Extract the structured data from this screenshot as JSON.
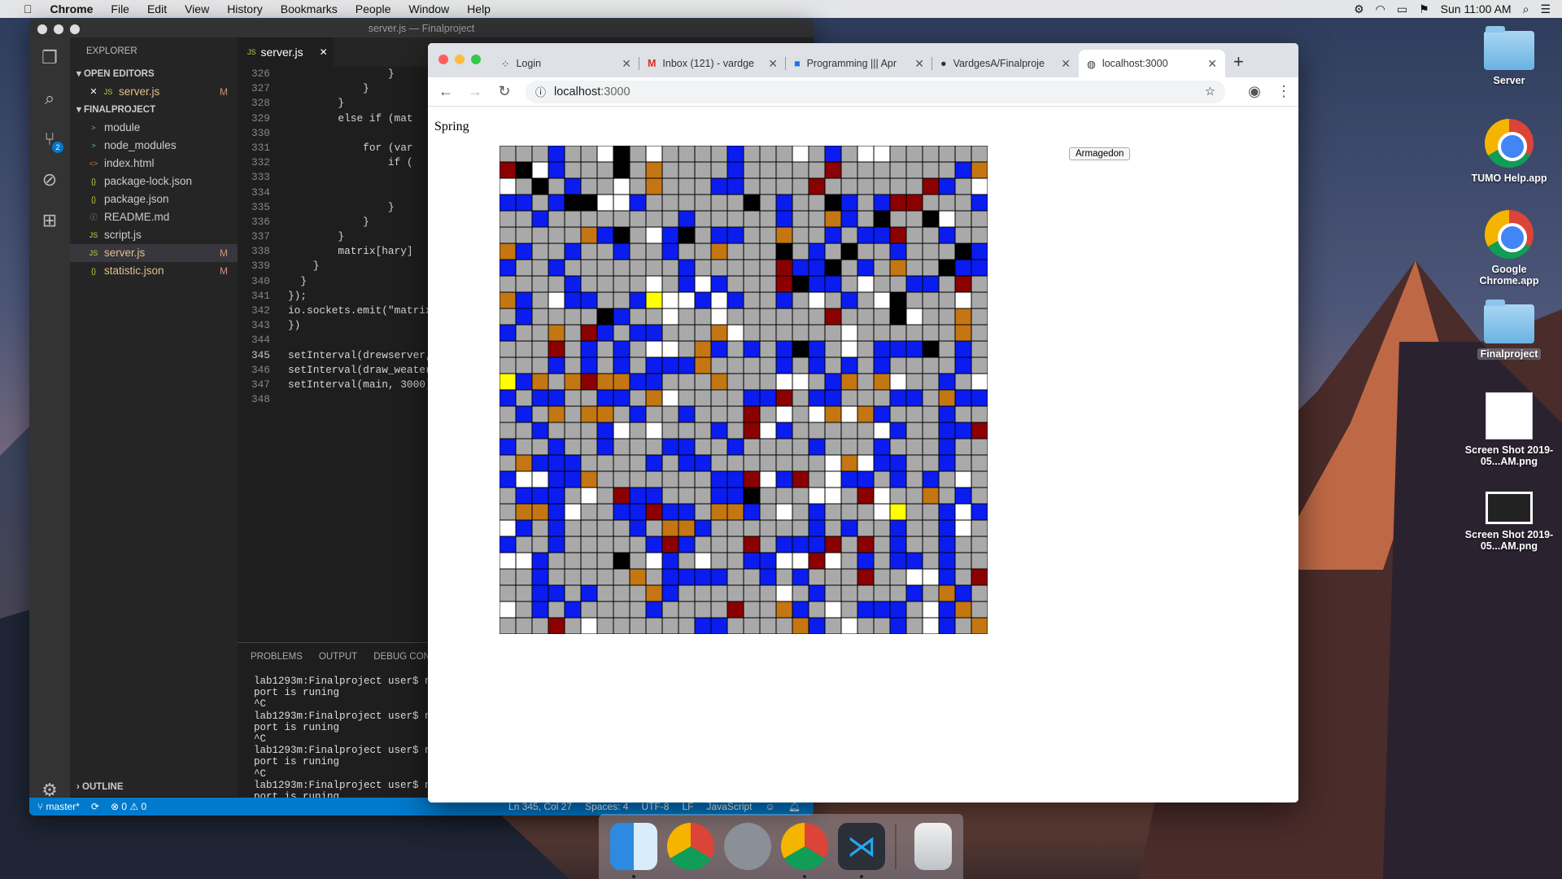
{
  "menubar": {
    "apple": "",
    "app": "Chrome",
    "items": [
      "File",
      "Edit",
      "View",
      "History",
      "Bookmarks",
      "People",
      "Window",
      "Help"
    ],
    "clock": "Sun 11:00 AM"
  },
  "vscode": {
    "title": "server.js — Finalproject",
    "explorer_label": "EXPLORER",
    "open_editors_label": "OPEN EDITORS",
    "open_editor_file": "server.js",
    "open_editor_status": "M",
    "project_label": "FINALPROJECT",
    "scm_badge": "2",
    "files": [
      {
        "name": "module",
        "icon": ">",
        "status": ""
      },
      {
        "name": "node_modules",
        "icon": ">",
        "status": ""
      },
      {
        "name": "index.html",
        "icon": "<>",
        "status": ""
      },
      {
        "name": "package-lock.json",
        "icon": "{}",
        "status": ""
      },
      {
        "name": "package.json",
        "icon": "{}",
        "status": ""
      },
      {
        "name": "README.md",
        "icon": "ⓘ",
        "status": ""
      },
      {
        "name": "script.js",
        "icon": "JS",
        "status": ""
      },
      {
        "name": "server.js",
        "icon": "JS",
        "status": "M"
      },
      {
        "name": "statistic.json",
        "icon": "{}",
        "status": "M"
      }
    ],
    "outline_label": "OUTLINE",
    "tab": "server.js",
    "code_lines": [
      {
        "n": "326",
        "t": "                }"
      },
      {
        "n": "327",
        "t": "            }"
      },
      {
        "n": "328",
        "t": "        }"
      },
      {
        "n": "329",
        "t": "        else if (mat"
      },
      {
        "n": "330",
        "t": ""
      },
      {
        "n": "331",
        "t": "            for (var"
      },
      {
        "n": "332",
        "t": "                if ("
      },
      {
        "n": "333",
        "t": ""
      },
      {
        "n": "334",
        "t": ""
      },
      {
        "n": "335",
        "t": "                }"
      },
      {
        "n": "336",
        "t": "            }"
      },
      {
        "n": "337",
        "t": "        }"
      },
      {
        "n": "338",
        "t": "        matrix[hary]"
      },
      {
        "n": "339",
        "t": "    }"
      },
      {
        "n": "340",
        "t": "  }"
      },
      {
        "n": "341",
        "t": "});"
      },
      {
        "n": "342",
        "t": "io.sockets.emit(\"matrix\""
      },
      {
        "n": "343",
        "t": "})"
      },
      {
        "n": "344",
        "t": ""
      },
      {
        "n": "345",
        "t": "setInterval(drewserver, 1500"
      },
      {
        "n": "346",
        "t": "setInterval(draw_weater, 700"
      },
      {
        "n": "347",
        "t": "setInterval(main, 3000);"
      },
      {
        "n": "348",
        "t": ""
      }
    ],
    "panel_tabs": [
      "PROBLEMS",
      "OUTPUT",
      "DEBUG CONSOLE"
    ],
    "terminal": [
      "lab1293m:Finalproject user$ node ser",
      "port is runing",
      "^C",
      "lab1293m:Finalproject user$ node ser",
      "port is runing",
      "^C",
      "lab1293m:Finalproject user$ node ser",
      "port is runing",
      "^C",
      "lab1293m:Finalproject user$ node ser",
      "port is runing"
    ],
    "status": {
      "branch": "master*",
      "errors": "0",
      "warnings": "0",
      "position": "Ln 345, Col 27",
      "spaces": "Spaces: 4",
      "encoding": "UTF-8",
      "eol": "LF",
      "language": "JavaScript"
    }
  },
  "chrome": {
    "tabs": [
      {
        "title": "Login",
        "icon": "dots-icon"
      },
      {
        "title": "Inbox (121) - vardge",
        "icon": "gmail-icon"
      },
      {
        "title": "Programming ||| Apr",
        "icon": "classroom-icon"
      },
      {
        "title": "VardgesA/Finalproje",
        "icon": "github-icon"
      },
      {
        "title": "localhost:3000",
        "icon": "globe-icon"
      }
    ],
    "address_host": "localhost",
    "address_port": ":3000",
    "page": {
      "season": "Spring",
      "button": "Armagedon",
      "grid_cols": 30,
      "grid_rows": 30,
      "colors": {
        "g": "#a9a9a9",
        "b": "#0a1cf0",
        "w": "#ffffff",
        "k": "#000000",
        "r": "#8b0000",
        "o": "#c47612",
        "y": "#ffff00"
      },
      "matrix": [
        "gggbggwkgwggggbgggwgbgwwgggggg",
        "rkwbgggkgoggggbgggggrgggggggbo",
        "wgkgbggwgogggbbggggrggggggrbgw",
        "bbgbkkwwbggggggkgbggkbgbrrgggb",
        "ggbggggggggbgggggbggobgkggkwgg",
        "gggggobkgwbkgbbggoggbgbbrggbgg",
        "obggbggbggbggogggkgbgkggbgggkb",
        "bggbgggggggbgggggrbbkgbgoggkbb",
        "ggggbggggwgbwbgggrkbbgwggbbgrg",
        "obgwbbggbywwbwbggbgwgbgwkgggwg",
        "gbggggkbggwggwggggggrgggkwggog",
        "bggogrbgbbgggowggggggwggggggog",
        "gggrgbgbgwwgobgbgbkbgwgbbbkgbg",
        "gggbgbgbgbbboggggbgbgbgbggggbg",
        "ybogoroobbgggogggwwgbogowggbgw",
        "bgbbggbbgowggggbbrgbbgggbbgobb",
        "gbgogoogbggbgggrgwgwowobgggbgg",
        "ggbgggbwgwgggbgrwbgggggwbggbbr",
        "bggbggbgggbbggbggggbgggbgggbgg",
        "gobbbggggbgbbgggggggwowbbggbgg",
        "bwwbbogggggggbbrwbrgwbbgbgbgwg",
        "gbbbgwgrbbgggbbkgggwwgrwggogbg",
        "goobwggbbrbbgoobgwgbgggwyggbwb",
        "wbgbggggbgoobggggggbgbggbggbwg",
        "bggbgggggbrbgggrgbbbrgrgbggbgg",
        "wwbggggkgwbgwggbbwwrwgbgbbgbgg",
        "ggbgggggogbbbbggbgbgggrggwwbgr",
        "ggbbgbgggobggggggwgbgggggbgobg",
        "wgbgbggggbggggrggobgwgbbbgwbog",
        "gggrgwggggggbbggggobgwggbgwbgo"
      ]
    }
  },
  "desktop": {
    "icons": [
      {
        "label": "Server",
        "kind": "folder"
      },
      {
        "label": "TUMO Help.app",
        "kind": "chrome"
      },
      {
        "label": "Google Chrome.app",
        "kind": "chrome"
      },
      {
        "label": "Finalproject",
        "kind": "folder"
      },
      {
        "label": "Screen Shot 2019-05...AM.png",
        "kind": "shot"
      },
      {
        "label": "Screen Shot 2019-05...AM.png",
        "kind": "shot"
      }
    ]
  },
  "dock": {
    "apps": [
      "Finder",
      "Google Chrome",
      "Launchpad",
      "Google Chrome",
      "Visual Studio Code",
      "Trash"
    ]
  }
}
